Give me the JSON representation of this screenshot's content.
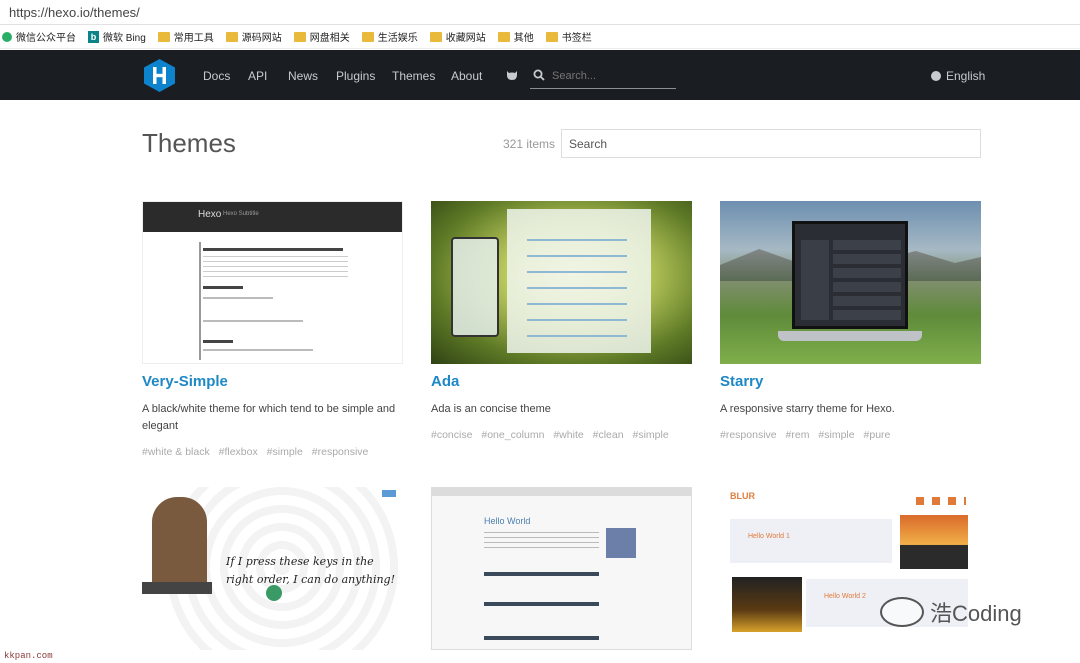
{
  "browser": {
    "url": "https://hexo.io/themes/",
    "bookmarks": [
      "微信公众平台",
      "微软 Bing",
      "常用工具",
      "源码网站",
      "网盘相关",
      "生活娱乐",
      "收藏网站",
      "其他",
      "书签栏"
    ]
  },
  "nav": {
    "links": [
      "Docs",
      "API",
      "News",
      "Plugins",
      "Themes",
      "About"
    ],
    "search_placeholder": "Search...",
    "language": "English",
    "colors": {
      "bar": "#1a1d21",
      "logo": "#0e83cd"
    }
  },
  "page": {
    "title": "Themes",
    "count": "321 items",
    "search_placeholder": "Search"
  },
  "themes": [
    {
      "title": "Very-Simple",
      "desc": "A black/white theme for which tend to be simple and elegant",
      "tags": [
        "#white & black",
        "#flexbox",
        "#simple",
        "#responsive"
      ],
      "thumb_title": "Hexo",
      "thumb_sub": "Hexo Subtitle"
    },
    {
      "title": "Ada",
      "desc": "Ada is an concise theme",
      "tags": [
        "#concise",
        "#one_column",
        "#white",
        "#clean",
        "#simple"
      ]
    },
    {
      "title": "Starry",
      "desc": "A responsive starry theme for Hexo.",
      "tags": [
        "#responsive",
        "#rem",
        "#simple",
        "#pure"
      ]
    }
  ],
  "second_row": {
    "t1_caption": "If I press these keys in the right order, I can do anything!",
    "t2_title": "Hello World",
    "t3_brand": "BLUR",
    "t3_post1": "Hello World 1",
    "t3_post2": "Hello World 2"
  },
  "watermarks": {
    "wechat": "浩Coding",
    "site": "kkpan.com"
  }
}
